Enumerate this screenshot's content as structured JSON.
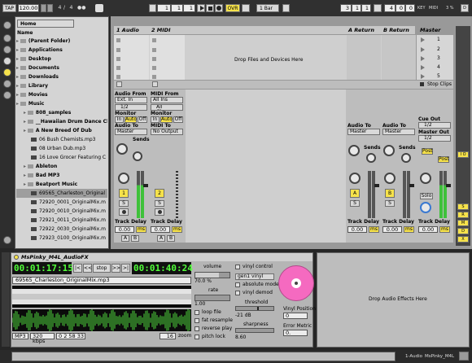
{
  "transport": {
    "tap": "TAP",
    "tempo": "120.00",
    "sig_num": "4",
    "sig_slash": "/",
    "sig_den": "4",
    "metro": "●●",
    "pos1": "1",
    "pos2": "1",
    "pos3": "1",
    "ovr": "OVR",
    "quant": "1 Bar",
    "loop_pos1": "3",
    "loop_pos2": "1",
    "loop_pos3": "1",
    "loop_len1": "4",
    "loop_len2": "0",
    "loop_len3": "0",
    "key": "KEY",
    "midi": "MIDI",
    "cpu": "3 %",
    "d_badge": "D"
  },
  "browser": {
    "location": "Home",
    "name_header": "Name",
    "rows": [
      {
        "label": "(Parent Folder)",
        "indent": 0
      },
      {
        "label": "Applications",
        "indent": 0
      },
      {
        "label": "Desktop",
        "indent": 0
      },
      {
        "label": "Documents",
        "indent": 0
      },
      {
        "label": "Downloads",
        "indent": 0
      },
      {
        "label": "Library",
        "indent": 0
      },
      {
        "label": "Movies",
        "indent": 0
      },
      {
        "label": "Music",
        "indent": 0
      },
      {
        "label": "808_samples",
        "indent": 1
      },
      {
        "label": "__Hawaiian Drum Dance Char",
        "indent": 1
      },
      {
        "label": "A New Breed Of Dub",
        "indent": 1
      },
      {
        "label": "06 Bush Chemists.mp3",
        "indent": 2
      },
      {
        "label": "08 Urban Dub.mp3",
        "indent": 2
      },
      {
        "label": "16 Love Grocer Featuring C",
        "indent": 2
      },
      {
        "label": "Ableton",
        "indent": 1
      },
      {
        "label": "Bad MP3",
        "indent": 1
      },
      {
        "label": "Beatport Music",
        "indent": 1
      },
      {
        "label": "69565_Charleston_Original",
        "indent": 2
      },
      {
        "label": "72920_0001_OriginalMix.m",
        "indent": 2
      },
      {
        "label": "72920_0010_OriginalMix.m",
        "indent": 2
      },
      {
        "label": "72921_0011_OriginalMix.m",
        "indent": 2
      },
      {
        "label": "72922_0030_OriginalMix.m",
        "indent": 2
      },
      {
        "label": "72923_0100_OriginalMix.m",
        "indent": 2
      }
    ]
  },
  "session": {
    "tracks": [
      "1 Audio",
      "2 MIDI"
    ],
    "returns": [
      "A Return",
      "B Return"
    ],
    "master": "Master",
    "drop_files": "Drop Files and Devices Here",
    "scene_numbers": [
      "1",
      "2",
      "3",
      "4",
      "5"
    ],
    "stop_clips": "Stop Clips",
    "io": {
      "audio_from": "Audio From",
      "audio_from_val": "Ext. In",
      "audio_ch": "1/2",
      "midi_from": "MIDI From",
      "midi_from_val": "All Ins",
      "midi_ch": "All Channe",
      "monitor": "Monitor",
      "mon_in": "In",
      "mon_auto": "Auto",
      "mon_off": "Off",
      "audio_to": "Audio To",
      "master_opt": "Master",
      "midi_to": "MIDI To",
      "no_output": "No Output",
      "cue_out": "Cue Out",
      "cue_val": "1/2",
      "master_out": "Master Out",
      "master_out_val": "1/2"
    },
    "sends": "Sends",
    "post": "Post",
    "track_num_1": "1",
    "track_num_2": "2",
    "ret_a": "A",
    "ret_b": "B",
    "solo_s": "S",
    "solo_label": "Solo",
    "track_delay": "Track Delay",
    "delay_val": "0.00",
    "ms": "ms",
    "a_btn": "A",
    "b_btn": "B",
    "io_btn": "I O",
    "sends_btn": "S",
    "returns_btn": "R",
    "mix_btn": "M",
    "d_btn": "D",
    "x_btn": "X"
  },
  "device": {
    "title": "MsPinky_M4L_AudioFX",
    "time_left": "00:01:17:15",
    "time_right": "00:01:40:24",
    "back_btn": "|<",
    "rew_btn": "<<",
    "stop_btn": "stop",
    "ff_btn": ">>",
    "end_btn": ">|",
    "file_name": "69565_Charleston_OriginalMix.mp3",
    "format": "MP3",
    "bitrate": "320 kbps",
    "duration": "0 2 58 33",
    "zoom_val": "16",
    "zoom": "zoom",
    "volume": "volume",
    "volume_val": "70.0 %",
    "rate": "rate",
    "rate_val": "1.00",
    "loop_file": "loop file",
    "fat_resample": "fat resample",
    "reverse_play": "reverse play",
    "pitch_lock": "pitch lock",
    "vinyl_control": "vinyl control",
    "vinyl_type": "gen1 vinyl",
    "absolute_mode": "absolute mode",
    "vinyl_demod": "vinyl demod",
    "threshold": "threshold",
    "threshold_val": "-21 dB",
    "sharpness": "sharpness",
    "sharpness_val": "8.60",
    "vinyl_position": "Vinyl Position",
    "vinyl_position_val": "0",
    "error_metric": "Error Metric",
    "error_metric_val": "0.",
    "drop_effects": "Drop Audio Effects Here"
  },
  "status": {
    "track": "1-Audio",
    "device": "MsPinky_M4L"
  },
  "colors": {
    "accent_yellow": "#f6e24b",
    "pink_vinyl": "#f56ac0",
    "lcd_green": "#52ff3a"
  }
}
